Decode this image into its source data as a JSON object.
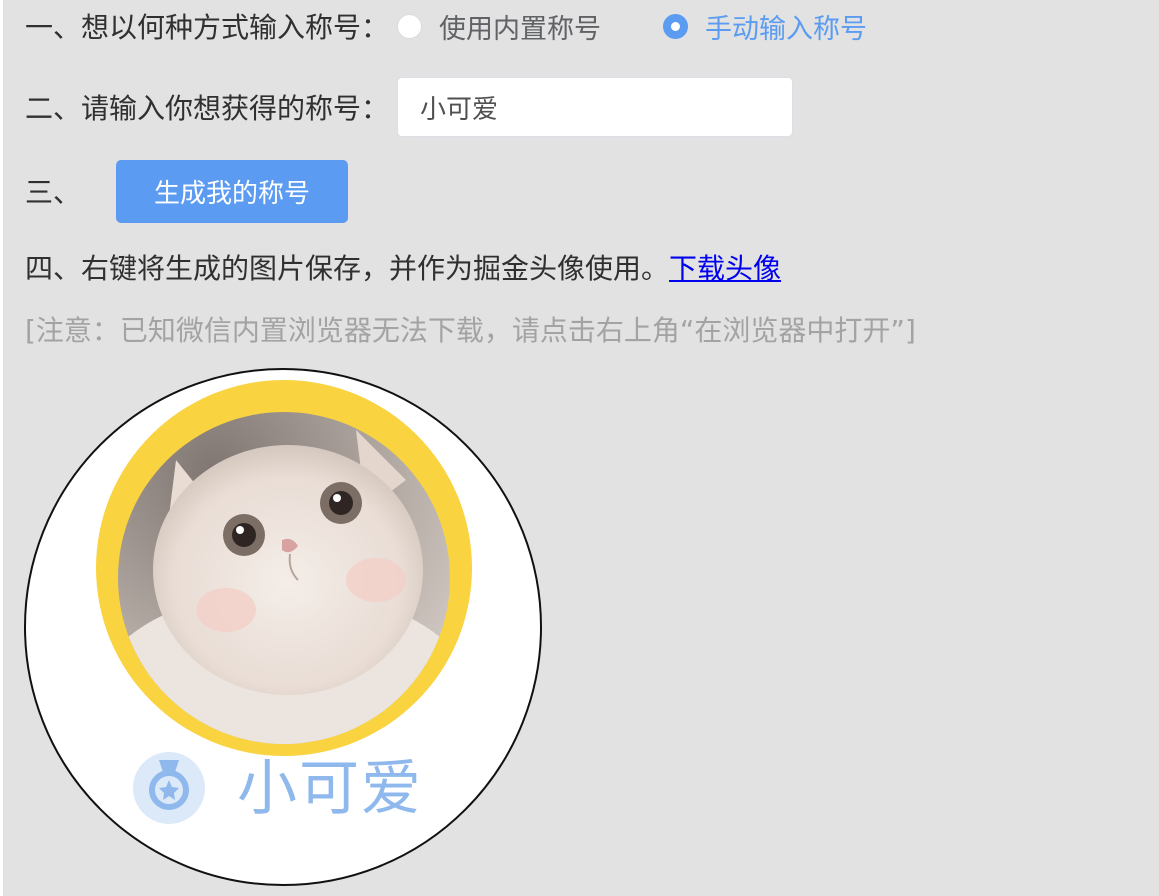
{
  "step1": {
    "label": "一、想以何种方式输入称号：",
    "options": [
      {
        "label": "使用内置称号",
        "checked": false
      },
      {
        "label": "手动输入称号",
        "checked": true
      }
    ]
  },
  "step2": {
    "label": "二、请输入你想获得的称号：",
    "value": "小可爱"
  },
  "step3": {
    "label": "三、",
    "button_label": "生成我的称号"
  },
  "step4": {
    "label": "四、右键将生成的图片保存，并作为掘金头像使用。",
    "link_text": "下载头像"
  },
  "note": "[注意：已知微信内置浏览器无法下载，请点击右上角“在浏览器中打开”]",
  "avatar": {
    "badge_text": "小可爱",
    "ring_color": "#f9d340",
    "badge_color": "#8fb8ec",
    "badge_icon": "medal-icon",
    "photo_subject": "kitten-photo"
  },
  "colors": {
    "accent": "#5b9cf2",
    "link": "#0000ee",
    "background": "#e2e2e2"
  }
}
